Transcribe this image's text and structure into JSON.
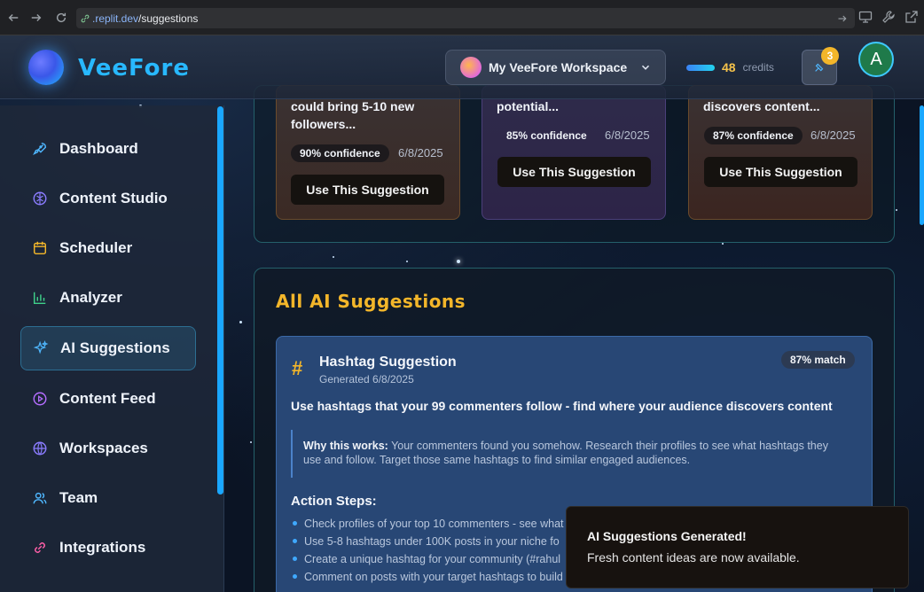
{
  "browser": {
    "url_domain": ".replit.dev",
    "url_path": "/suggestions"
  },
  "header": {
    "brand": "VeeFore",
    "workspace_label": "My VeeFore Workspace",
    "credits_value": "48",
    "credits_label": "credits",
    "notification_count": "3",
    "avatar_initial": "A"
  },
  "sidebar": {
    "items": [
      {
        "label": "Dashboard",
        "icon": "rocket-icon",
        "color": "#4fb7ff"
      },
      {
        "label": "Content Studio",
        "icon": "brain-icon",
        "color": "#8b7cff"
      },
      {
        "label": "Scheduler",
        "icon": "calendar-icon",
        "color": "#f3b62a"
      },
      {
        "label": "Analyzer",
        "icon": "bar-chart-icon",
        "color": "#3fd08a"
      },
      {
        "label": "AI Suggestions",
        "icon": "sparkles-icon",
        "color": "#4fb7ff",
        "active": true
      },
      {
        "label": "Content Feed",
        "icon": "play-circle-icon",
        "color": "#b46dff"
      },
      {
        "label": "Workspaces",
        "icon": "globe-icon",
        "color": "#8b7cff"
      },
      {
        "label": "Team",
        "icon": "users-icon",
        "color": "#4fb7ff"
      },
      {
        "label": "Integrations",
        "icon": "link-icon",
        "color": "#ff5fa8"
      }
    ]
  },
  "top_cards": [
    {
      "title_lines": [
        "could bring 5-10 new",
        "followers..."
      ],
      "confidence": "90% confidence",
      "date": "6/8/2025",
      "button": "Use This Suggestion"
    },
    {
      "title_lines": [
        "potential..."
      ],
      "confidence": "85% confidence",
      "date": "6/8/2025",
      "button": "Use This Suggestion"
    },
    {
      "title_lines": [
        "discovers content..."
      ],
      "confidence": "87% confidence",
      "date": "6/8/2025",
      "button": "Use This Suggestion"
    }
  ],
  "all_suggestions": {
    "title": "All AI Suggestions",
    "card": {
      "icon": "#",
      "title": "Hashtag Suggestion",
      "generated": "Generated 6/8/2025",
      "match": "87% match",
      "headline": "Use hashtags that your 99 commenters follow - find where your audience discovers content",
      "why_label": "Why this works:",
      "why_text": " Your commenters found you somehow. Research their profiles to see what hashtags they use and follow. Target those same hashtags to find similar engaged audiences.",
      "steps_title": "Action Steps:",
      "steps": [
        "Check profiles of your top 10 commenters - see what",
        "Use 5-8 hashtags under 100K posts in your niche fo",
        "Create a unique hashtag for your community (#rahul",
        "Comment on posts with your target hashtags to build"
      ]
    }
  },
  "toast": {
    "title": "AI Suggestions Generated!",
    "body": "Fresh content ideas are now available."
  }
}
